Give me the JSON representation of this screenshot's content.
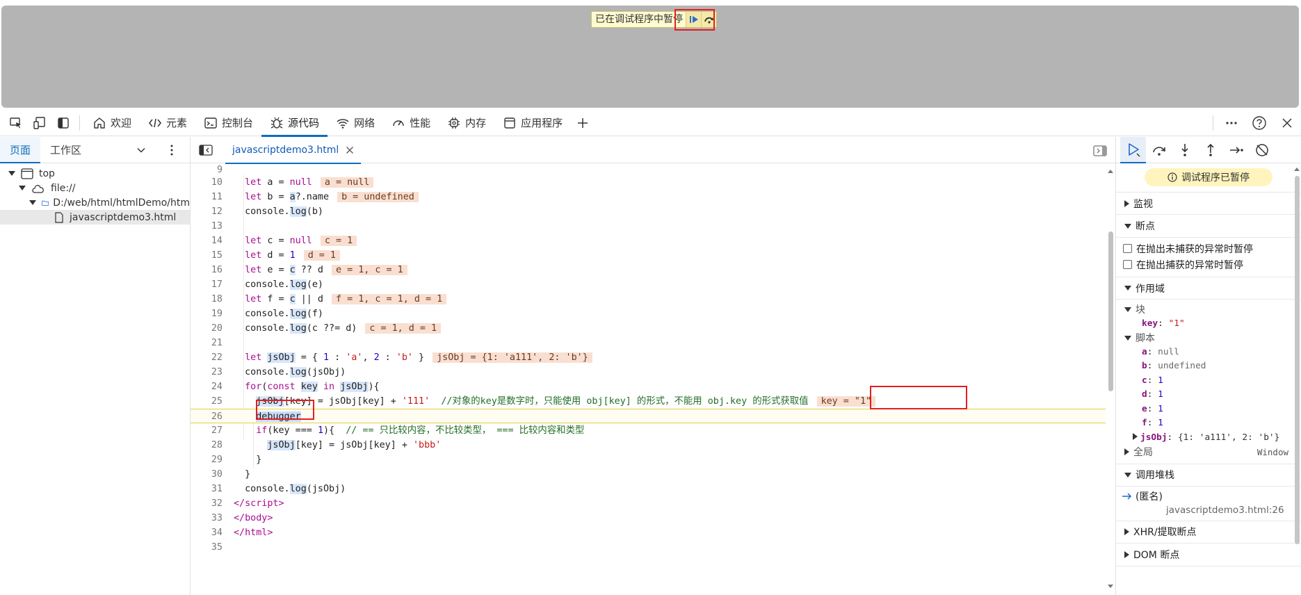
{
  "page": {
    "pause_text": "已在调试程序中暂停",
    "resume_icon": "resume-icon",
    "step_over_icon": "step-over-icon"
  },
  "tabbar": {
    "tabs": [
      {
        "label": "欢迎",
        "icon": "home-icon"
      },
      {
        "label": "元素",
        "icon": "code-tag-icon"
      },
      {
        "label": "控制台",
        "icon": "console-icon"
      },
      {
        "label": "源代码",
        "icon": "bug-icon"
      },
      {
        "label": "网络",
        "icon": "wifi-icon"
      },
      {
        "label": "性能",
        "icon": "gauge-icon"
      },
      {
        "label": "内存",
        "icon": "chip-icon"
      },
      {
        "label": "应用程序",
        "icon": "app-window-icon"
      }
    ],
    "active_tab": "源代码",
    "add_tab_icon": "plus-icon"
  },
  "navigator": {
    "tabs": [
      "页面",
      "工作区"
    ],
    "active": "页面",
    "tree": {
      "top": "top",
      "file": "file://",
      "folder": "D:/web/html/htmlDemo/htm",
      "file_name": "javascriptdemo3.html"
    }
  },
  "editor": {
    "file_tab": "javascriptdemo3.html",
    "paused_line": 26
  },
  "debugger": {
    "status": "调试程序已暂停",
    "sections": {
      "watch": "监视",
      "breakpoints": "断点",
      "scope": "作用域",
      "call_stack": "调用堆栈",
      "xhr": "XHR/提取断点",
      "dom": "DOM 断点"
    },
    "exceptions": {
      "uncaught": "在抛出未捕获的异常时暂停",
      "caught": "在抛出捕获的异常时暂停"
    },
    "scope": {
      "block_label": "块",
      "block_vars": [
        {
          "name": "key",
          "value": "\"1\"",
          "kind": "str"
        }
      ],
      "script_label": "脚本",
      "script_vars": [
        {
          "name": "a",
          "value": "null",
          "kind": "null"
        },
        {
          "name": "b",
          "value": "undefined",
          "kind": "null"
        },
        {
          "name": "c",
          "value": "1",
          "kind": "num"
        },
        {
          "name": "d",
          "value": "1",
          "kind": "num"
        },
        {
          "name": "e",
          "value": "1",
          "kind": "num"
        },
        {
          "name": "f",
          "value": "1",
          "kind": "num"
        }
      ],
      "jsobj_name": "jsObj",
      "jsobj_value": "{1: 'a111', 2: 'b'}",
      "global_label": "全局",
      "global_value": "Window"
    },
    "call_stack": {
      "frame_name": "(匿名)",
      "frame_location": "javascriptdemo3.html:26"
    }
  }
}
